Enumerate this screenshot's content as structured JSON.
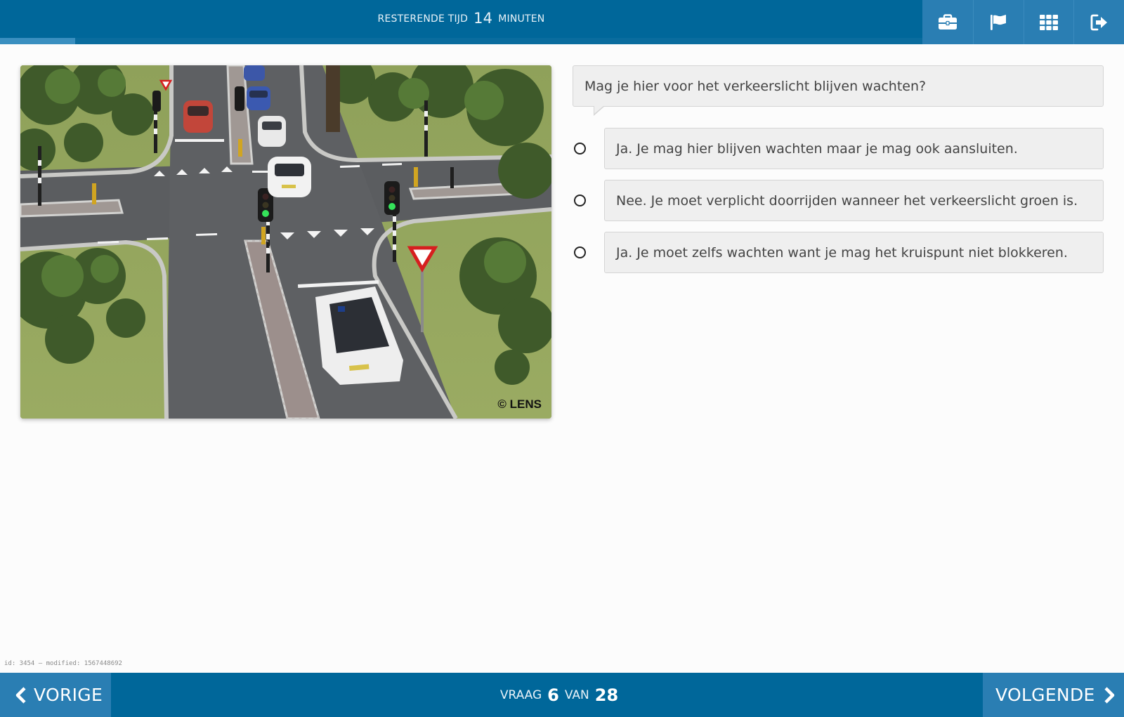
{
  "header": {
    "timer_prefix": "RESTERENDE TIJD",
    "timer_value": "14",
    "timer_suffix": "MINUTEN",
    "progress_fraction": 0.0813,
    "tools": [
      {
        "icon": "briefcase-icon"
      },
      {
        "icon": "flag-icon"
      },
      {
        "icon": "grid-icon"
      },
      {
        "icon": "sign-out-icon"
      }
    ]
  },
  "image": {
    "copyright": "© LENS"
  },
  "question": {
    "text": "Mag je hier voor het verkeerslicht blijven wachten?",
    "answers": [
      "Ja. Je mag hier blijven wachten maar je mag ook aansluiten.",
      "Nee. Je moet verplicht doorrijden wanneer het verkeerslicht groen is.",
      "Ja. Je moet zelfs wachten want je mag het kruispunt niet blokkeren."
    ]
  },
  "debug_text": "id: 3454 — modified: 1567448692",
  "footer": {
    "prev_label": "VORIGE",
    "next_label": "VOLGENDE",
    "counter_prefix": "VRAAG",
    "current": "6",
    "counter_mid": "VAN",
    "total": "28"
  },
  "colors": {
    "bar": "#00679a",
    "button": "#2a7eb3",
    "panel": "#efefef"
  }
}
